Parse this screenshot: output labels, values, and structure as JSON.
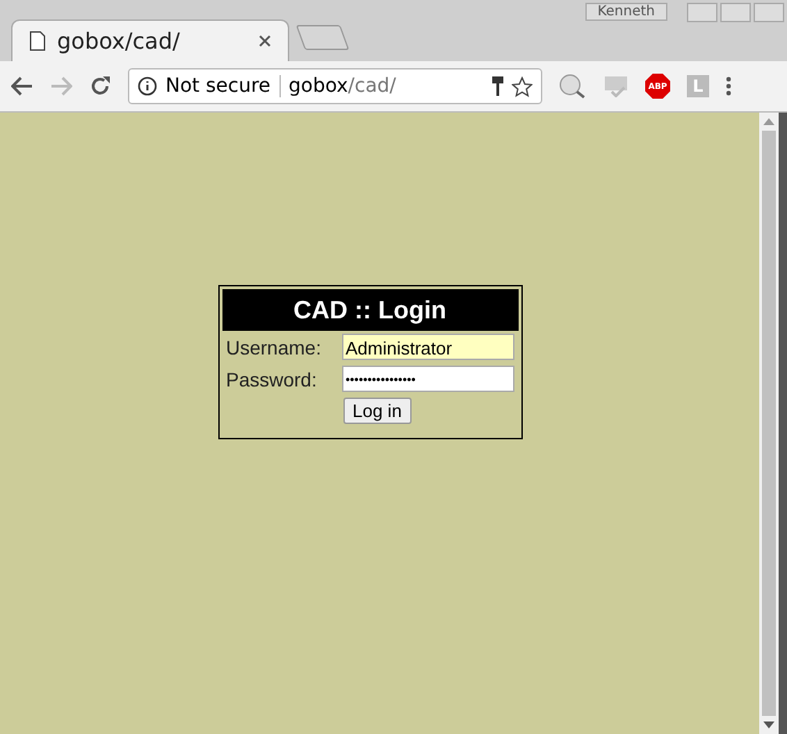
{
  "window": {
    "profile": "Kenneth"
  },
  "tabs": [
    {
      "title": "gobox/cad/",
      "selected": true
    }
  ],
  "address_bar": {
    "security": "Not secure",
    "host": "gobox",
    "path": "/cad/"
  },
  "extensions": [
    {
      "kind": "ip"
    },
    {
      "kind": "css"
    },
    {
      "kind": "abp",
      "label": "ABP"
    },
    {
      "kind": "letter",
      "label": "L"
    }
  ],
  "login": {
    "title": "CAD :: Login",
    "username_label": "Username:",
    "username_value": "Administrator",
    "password_label": "Password:",
    "password_mask": "••••••••••••••••",
    "button": "Log in"
  }
}
